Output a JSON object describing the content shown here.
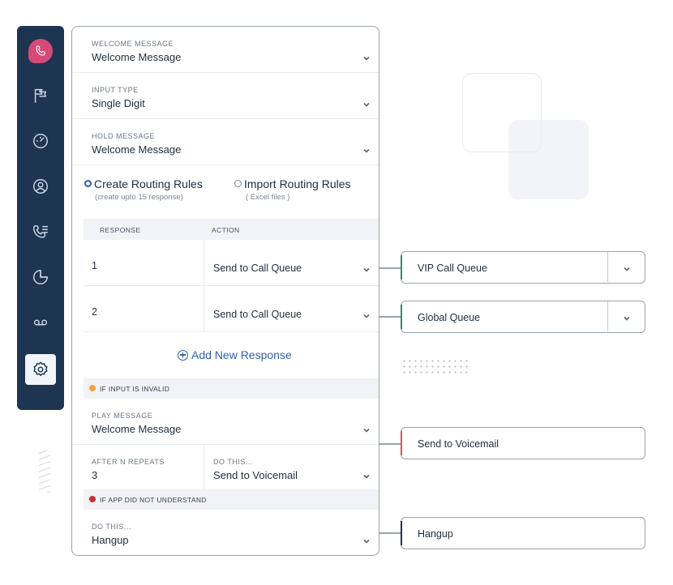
{
  "sidebar": {
    "icons": [
      "phone-icon",
      "flag-icon",
      "dashboard-icon",
      "user-icon",
      "call-list-icon",
      "pie-chart-icon",
      "voicemail-icon",
      "settings-icon"
    ]
  },
  "fields": {
    "welcome": {
      "label": "WELCOME MESSAGE",
      "value": "Welcome Message"
    },
    "input_type": {
      "label": "INPUT TYPE",
      "value": "Single Digit"
    },
    "hold": {
      "label": "HOLD MESSAGE",
      "value": "Welcome Message"
    }
  },
  "routing": {
    "create": {
      "label": "Create Routing Rules",
      "sub": "(create upto 15 response)"
    },
    "import": {
      "label": "Import Routing Rules",
      "sub": "( Excel files )"
    }
  },
  "table": {
    "headers": [
      "RESPONSE",
      "ACTION"
    ],
    "rows": [
      {
        "response": "1",
        "action": "Send to Call Queue"
      },
      {
        "response": "2",
        "action": "Send to Call Queue"
      }
    ]
  },
  "add_response": "Add New Response",
  "invalid": {
    "title": "IF INPUT IS INVALID",
    "dot_color": "#f2a23c",
    "play": {
      "label": "PLAY MESSAGE",
      "value": "Welcome Message"
    },
    "repeats": {
      "label": "AFTER N REPEATS",
      "value": "3"
    },
    "do_this": {
      "label": "DO THIS...",
      "value": "Send to Voicemail"
    }
  },
  "not_understand": {
    "title": "IF APP DID NOT UNDERSTAND",
    "dot_color": "#c9302c",
    "do_this": {
      "label": "DO THIS...",
      "value": "Hangup"
    }
  },
  "targets": [
    {
      "label": "VIP Call Queue",
      "accent": "#2e8b6e",
      "dropdown": true
    },
    {
      "label": "Global Queue",
      "accent": "#2e8b6e",
      "dropdown": true
    },
    {
      "label": "Send to Voicemail",
      "accent": "#d9534f",
      "dropdown": false
    },
    {
      "label": "Hangup",
      "accent": "#1e3552",
      "dropdown": false
    }
  ]
}
